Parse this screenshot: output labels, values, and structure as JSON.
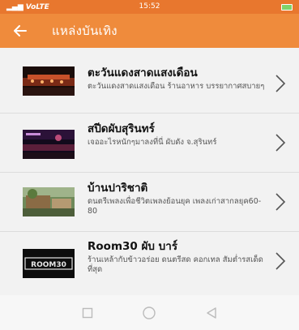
{
  "status_bar": {
    "signal": "▂▄▆",
    "carrier": "VoLTE",
    "time": "15:52"
  },
  "app_bar": {
    "title": "แหล่งบันเทิง"
  },
  "items": [
    {
      "title": "ตะวันแดงสาดแสงเดือน",
      "desc": "ตะวันแดงสาดแสงเดือน ร้านอาหาร บรรยากาศสบายๆ",
      "thumb_icon": "restaurant-night-photo"
    },
    {
      "title": "สปีดผับสุรินทร์",
      "desc": "เจออะไรหนักๆมาลงที่นี่ ผับดัง จ.สุรินทร์",
      "thumb_icon": "pub-stage-photo"
    },
    {
      "title": "บ้านปาริชาติ",
      "desc": "ดนตรีเพลงเพื่อชีวิตเพลงย้อนยุค เพลงเก่าสากลยุค60-80",
      "thumb_icon": "outdoor-venue-photo"
    },
    {
      "title": "Room30 ผับ บาร์",
      "desc": "ร้านเหล้ากับข้าวอร่อย ดนตรีสด คอกเทล สัมต่ำรสเด็ดที่สุด",
      "thumb_icon": "room30-logo",
      "logo_text": "ROOM30"
    }
  ],
  "colors": {
    "status_bar": "#e8772e",
    "app_bar": "#ef8b3c",
    "list_bg": "#f2f2f2"
  }
}
